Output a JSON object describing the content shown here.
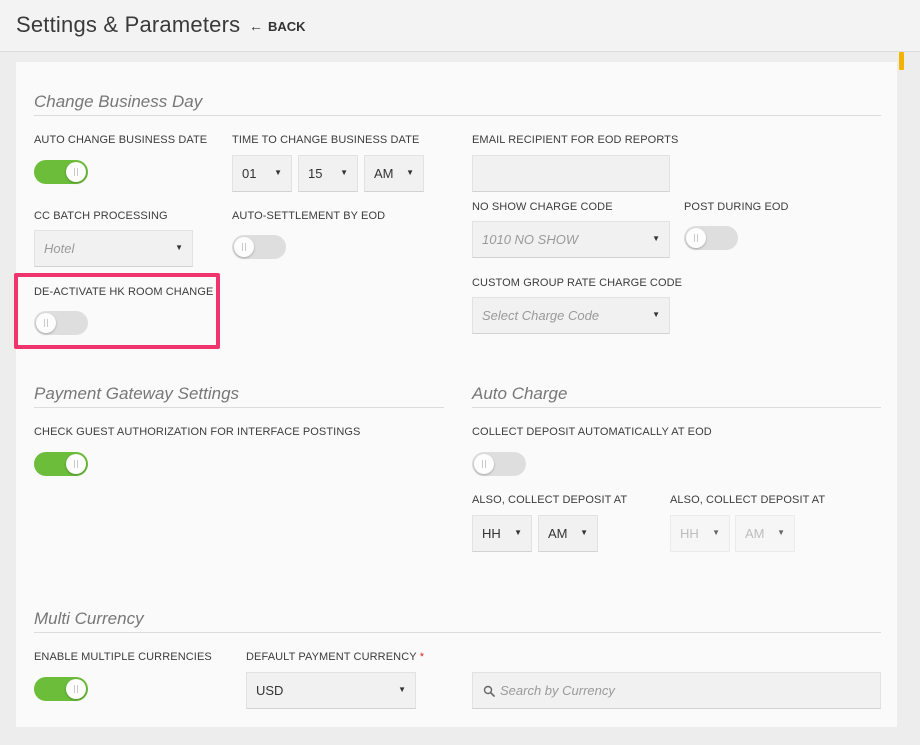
{
  "header": {
    "title": "Settings & Parameters",
    "back_arrow": "←",
    "back_label": "BACK"
  },
  "icons": {
    "back": "arrow-left-icon",
    "caret": "caret-down-icon",
    "search": "search-icon"
  },
  "colors": {
    "toggle_on": "#6bbd3a",
    "toggle_off": "#dedede",
    "highlight": "#f0346e",
    "required": "#d6282b",
    "scroll_indicator": "#f5b301"
  },
  "change_business_day": {
    "title": "Change Business Day",
    "auto_change_label": "AUTO CHANGE BUSINESS DATE",
    "auto_change_on": true,
    "time_label": "TIME TO CHANGE BUSINESS DATE",
    "time_hour": "01",
    "time_minute": "15",
    "time_ampm": "AM",
    "email_label": "EMAIL RECIPIENT FOR EOD REPORTS",
    "email_value": "",
    "cc_batch_label": "CC BATCH PROCESSING",
    "cc_batch_value": "Hotel",
    "auto_settle_label": "AUTO-SETTLEMENT BY EOD",
    "auto_settle_on": false,
    "no_show_label": "NO SHOW CHARGE CODE",
    "no_show_value": "1010 NO SHOW",
    "post_eod_label": "POST DURING EOD",
    "post_eod_on": false,
    "hk_label": "DE-ACTIVATE HK ROOM CHANGE",
    "hk_on": false,
    "custom_group_label": "CUSTOM GROUP RATE CHARGE CODE",
    "custom_group_placeholder": "Select Charge Code"
  },
  "payment_gateway": {
    "title": "Payment Gateway Settings",
    "check_label": "CHECK GUEST AUTHORIZATION FOR INTERFACE POSTINGS",
    "check_on": true
  },
  "auto_charge": {
    "title": "Auto Charge",
    "collect_label": "COLLECT DEPOSIT AUTOMATICALLY AT EOD",
    "collect_on": false,
    "also1_label": "ALSO, COLLECT DEPOSIT AT",
    "also1_hour": "HH",
    "also1_ampm": "AM",
    "also2_label": "ALSO, COLLECT DEPOSIT AT",
    "also2_hour": "HH",
    "also2_ampm": "AM"
  },
  "multi_currency": {
    "title": "Multi Currency",
    "enable_label": "ENABLE MULTIPLE CURRENCIES",
    "enable_on": true,
    "default_label": "DEFAULT PAYMENT CURRENCY",
    "required_mark": "*",
    "default_value": "USD",
    "search_placeholder": "Search by Currency"
  }
}
